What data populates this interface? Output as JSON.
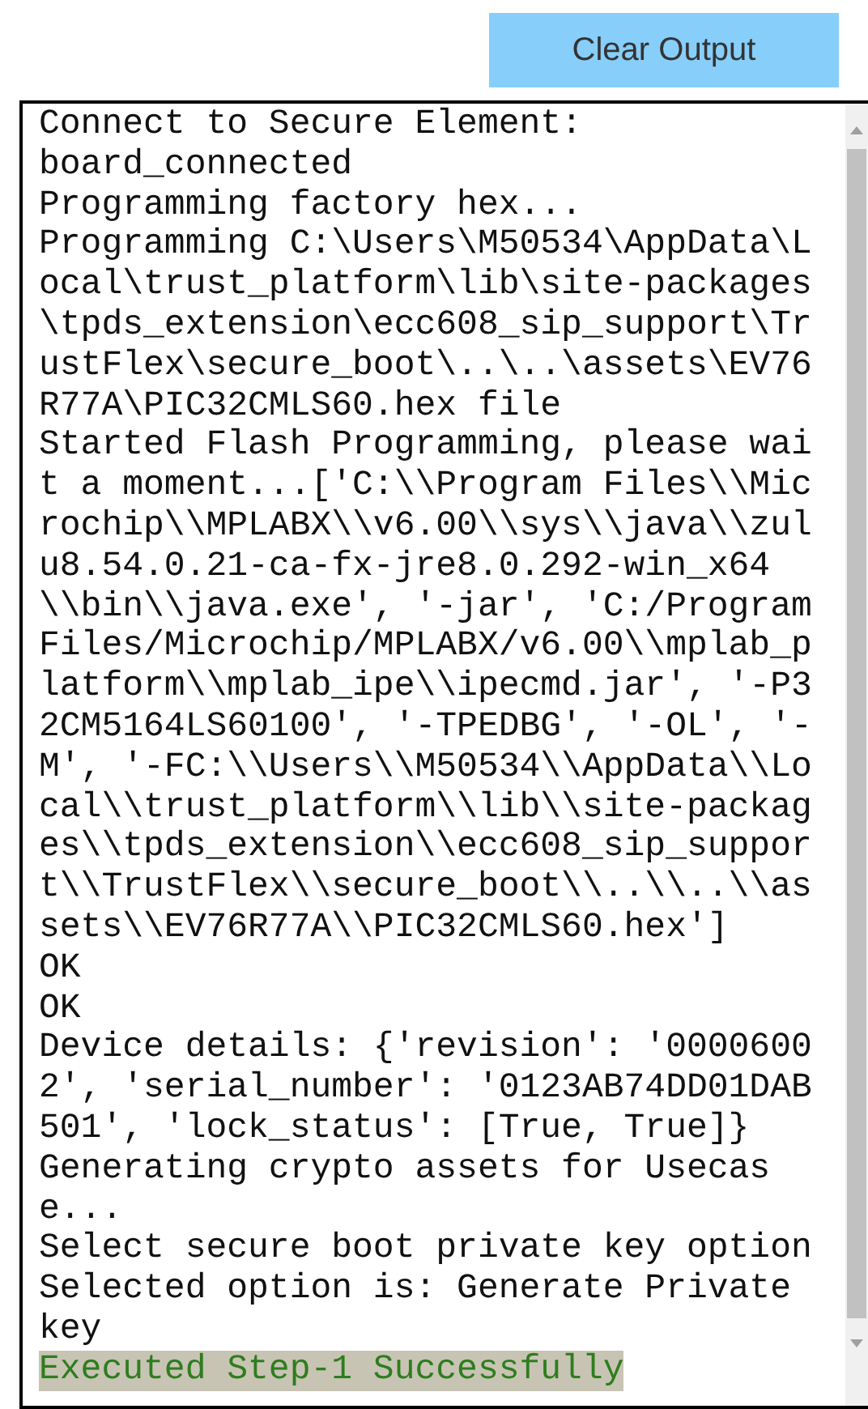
{
  "button": {
    "label": "Clear Output"
  },
  "output": {
    "lines": [
      {
        "kind": "text",
        "text": "Connect to Secure Element:"
      },
      {
        "kind": "text",
        "text": "board_connected"
      },
      {
        "kind": "text",
        "text": "Programming factory hex..."
      },
      {
        "kind": "text",
        "text": "Programming C:\\Users\\M50534\\AppData\\L"
      },
      {
        "kind": "text",
        "text": "ocal\\trust_platform\\lib\\site-packages"
      },
      {
        "kind": "text",
        "text": "\\tpds_extension\\ecc608_sip_support\\Tr"
      },
      {
        "kind": "text",
        "text": "ustFlex\\secure_boot\\..\\..\\assets\\EV76"
      },
      {
        "kind": "text",
        "text": "R77A\\PIC32CMLS60.hex file"
      },
      {
        "kind": "text",
        "text": "Started Flash Programming, please wai"
      },
      {
        "kind": "text",
        "text": "t a moment...['C:\\\\Program Files\\\\Mic"
      },
      {
        "kind": "text",
        "text": "rochip\\\\MPLABX\\\\v6.00\\\\sys\\\\java\\\\zul"
      },
      {
        "kind": "text",
        "text": "u8.54.0.21-ca-fx-jre8.0.292-win_x64"
      },
      {
        "kind": "text",
        "text": "\\\\bin\\\\java.exe', '-jar', 'C:/Program"
      },
      {
        "kind": "text",
        "text": "Files/Microchip/MPLABX/v6.00\\\\mplab_p"
      },
      {
        "kind": "text",
        "text": "latform\\\\mplab_ipe\\\\ipecmd.jar', '-P3"
      },
      {
        "kind": "text",
        "text": "2CM5164LS60100', '-TPEDBG', '-OL', '-"
      },
      {
        "kind": "text",
        "text": "M', '-FC:\\\\Users\\\\M50534\\\\AppData\\\\Lo"
      },
      {
        "kind": "text",
        "text": "cal\\\\trust_platform\\\\lib\\\\site-packag"
      },
      {
        "kind": "text",
        "text": "es\\\\tpds_extension\\\\ecc608_sip_suppor"
      },
      {
        "kind": "text",
        "text": "t\\\\TrustFlex\\\\secure_boot\\\\..\\\\..\\\\as"
      },
      {
        "kind": "text",
        "text": "sets\\\\EV76R77A\\\\PIC32CMLS60.hex']"
      },
      {
        "kind": "text",
        "text": "OK"
      },
      {
        "kind": "text",
        "text": "OK"
      },
      {
        "kind": "text",
        "text": "Device details: {'revision': '0000600"
      },
      {
        "kind": "text",
        "text": "2', 'serial_number': '0123AB74DD01DAB"
      },
      {
        "kind": "text",
        "text": "501', 'lock_status': [True, True]}"
      },
      {
        "kind": "text",
        "text": "Generating crypto assets for Usecas"
      },
      {
        "kind": "text",
        "text": "e..."
      },
      {
        "kind": "text",
        "text": "Select secure boot private key option"
      },
      {
        "kind": "text",
        "text": "Selected option is: Generate Private"
      },
      {
        "kind": "text",
        "text": "key"
      },
      {
        "kind": "success",
        "text": "Executed Step-1 Successfully"
      }
    ]
  }
}
